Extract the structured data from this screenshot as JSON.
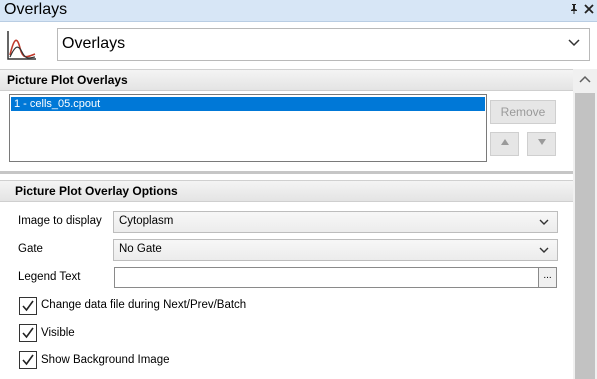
{
  "window": {
    "title": "Overlays",
    "pin_icon": "pin-icon",
    "close_icon": "close-icon"
  },
  "header": {
    "icon": "chart-overlay-icon",
    "selected": "Overlays"
  },
  "overlays_section": {
    "title": "Picture Plot Overlays",
    "items": [
      "1 - cells_05.cpout"
    ],
    "remove_label": "Remove",
    "up_icon": "up-arrow-icon",
    "down_icon": "down-arrow-icon"
  },
  "options_section": {
    "title": "Picture Plot Overlay Options",
    "image_to_display": {
      "label": "Image to display",
      "value": "Cytoplasm"
    },
    "gate": {
      "label": "Gate",
      "value": "No Gate"
    },
    "legend_text": {
      "label": "Legend Text",
      "value": "",
      "button_label": "..."
    },
    "checkboxes": [
      {
        "label": "Change data file during Next/Prev/Batch",
        "checked": true
      },
      {
        "label": "Visible",
        "checked": true
      },
      {
        "label": "Show Background Image",
        "checked": true
      }
    ]
  },
  "colors": {
    "title_bar": "#d7e6f6",
    "selection": "#0078d7",
    "disabled_button": "#e6e6e6"
  }
}
